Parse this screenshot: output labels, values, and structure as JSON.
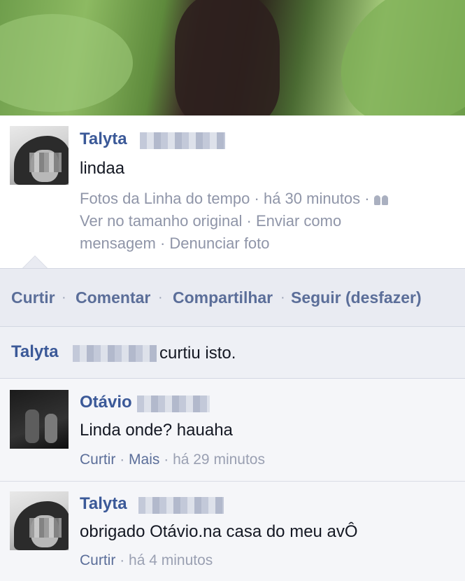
{
  "post": {
    "author_name": "Talyta",
    "text": "lindaa",
    "meta_line1_album": "Fotos da Linha do tempo",
    "meta_line1_time": "há 30 minutos",
    "meta_line2_view": "Ver no tamanho original",
    "meta_line2_send": "Enviar como",
    "meta_line3_send": "mensagem",
    "meta_line3_report": "Denunciar foto"
  },
  "actions": {
    "like": "Curtir",
    "comment": "Comentar",
    "share": "Compartilhar",
    "follow": "Seguir (desfazer)",
    "separator": "·"
  },
  "likes": {
    "name": "Talyta",
    "text": "curtiu isto."
  },
  "comments": [
    {
      "author_name": "Otávio",
      "text": "Linda onde? hauaha",
      "like": "Curtir",
      "more": "Mais",
      "time": "há 29 minutos"
    },
    {
      "author_name": "Talyta",
      "text": "obrigado Otávio.na casa do meu avÔ",
      "like": "Curtir",
      "time": "há 4 minutos"
    }
  ],
  "colors": {
    "link_blue": "#3b5998",
    "action_blue": "#5b6e99",
    "meta_gray": "#8f95a8",
    "bar_bg": "#e9ebf2"
  },
  "icons": [
    "audience-friends-icon"
  ]
}
